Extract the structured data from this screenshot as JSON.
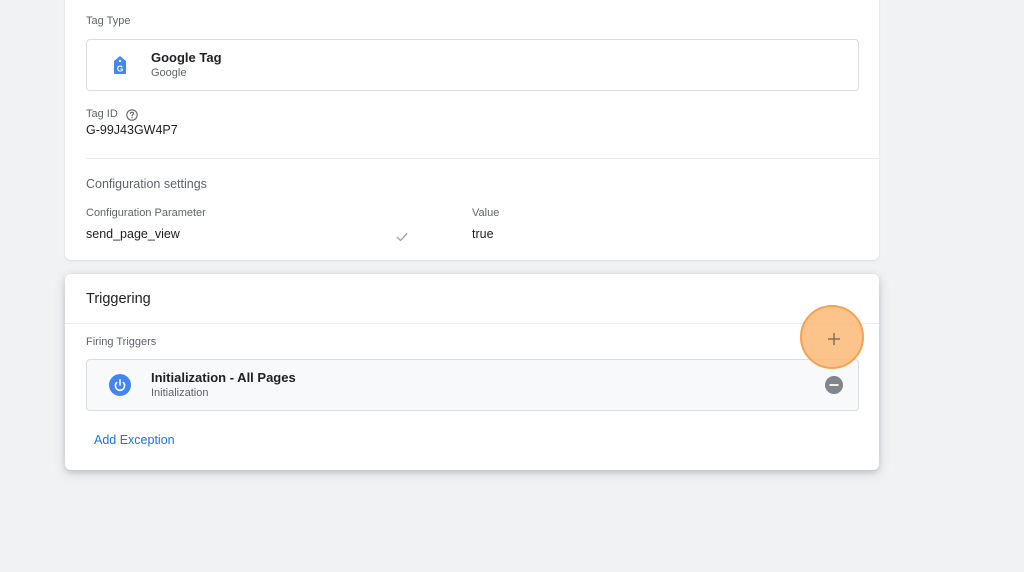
{
  "tag_config": {
    "tag_type_label": "Tag Type",
    "tag_type": {
      "name": "Google Tag",
      "subtitle": "Google",
      "icon": "google-tag-icon"
    },
    "tag_id_label": "Tag ID",
    "tag_id_value": "G-99J43GW4P7",
    "config_settings_title": "Configuration settings",
    "param_header": "Configuration Parameter",
    "value_header": "Value",
    "parameters": [
      {
        "name": "send_page_view",
        "value": "true"
      }
    ]
  },
  "triggering": {
    "title": "Triggering",
    "firing_label": "Firing Triggers",
    "triggers": [
      {
        "name": "Initialization - All Pages",
        "type": "Initialization",
        "icon": "power-icon"
      }
    ],
    "add_exception_label": "Add Exception"
  },
  "colors": {
    "accent": "#1a73e8",
    "highlight": "#f4a256",
    "background": "#f1f2f4"
  }
}
